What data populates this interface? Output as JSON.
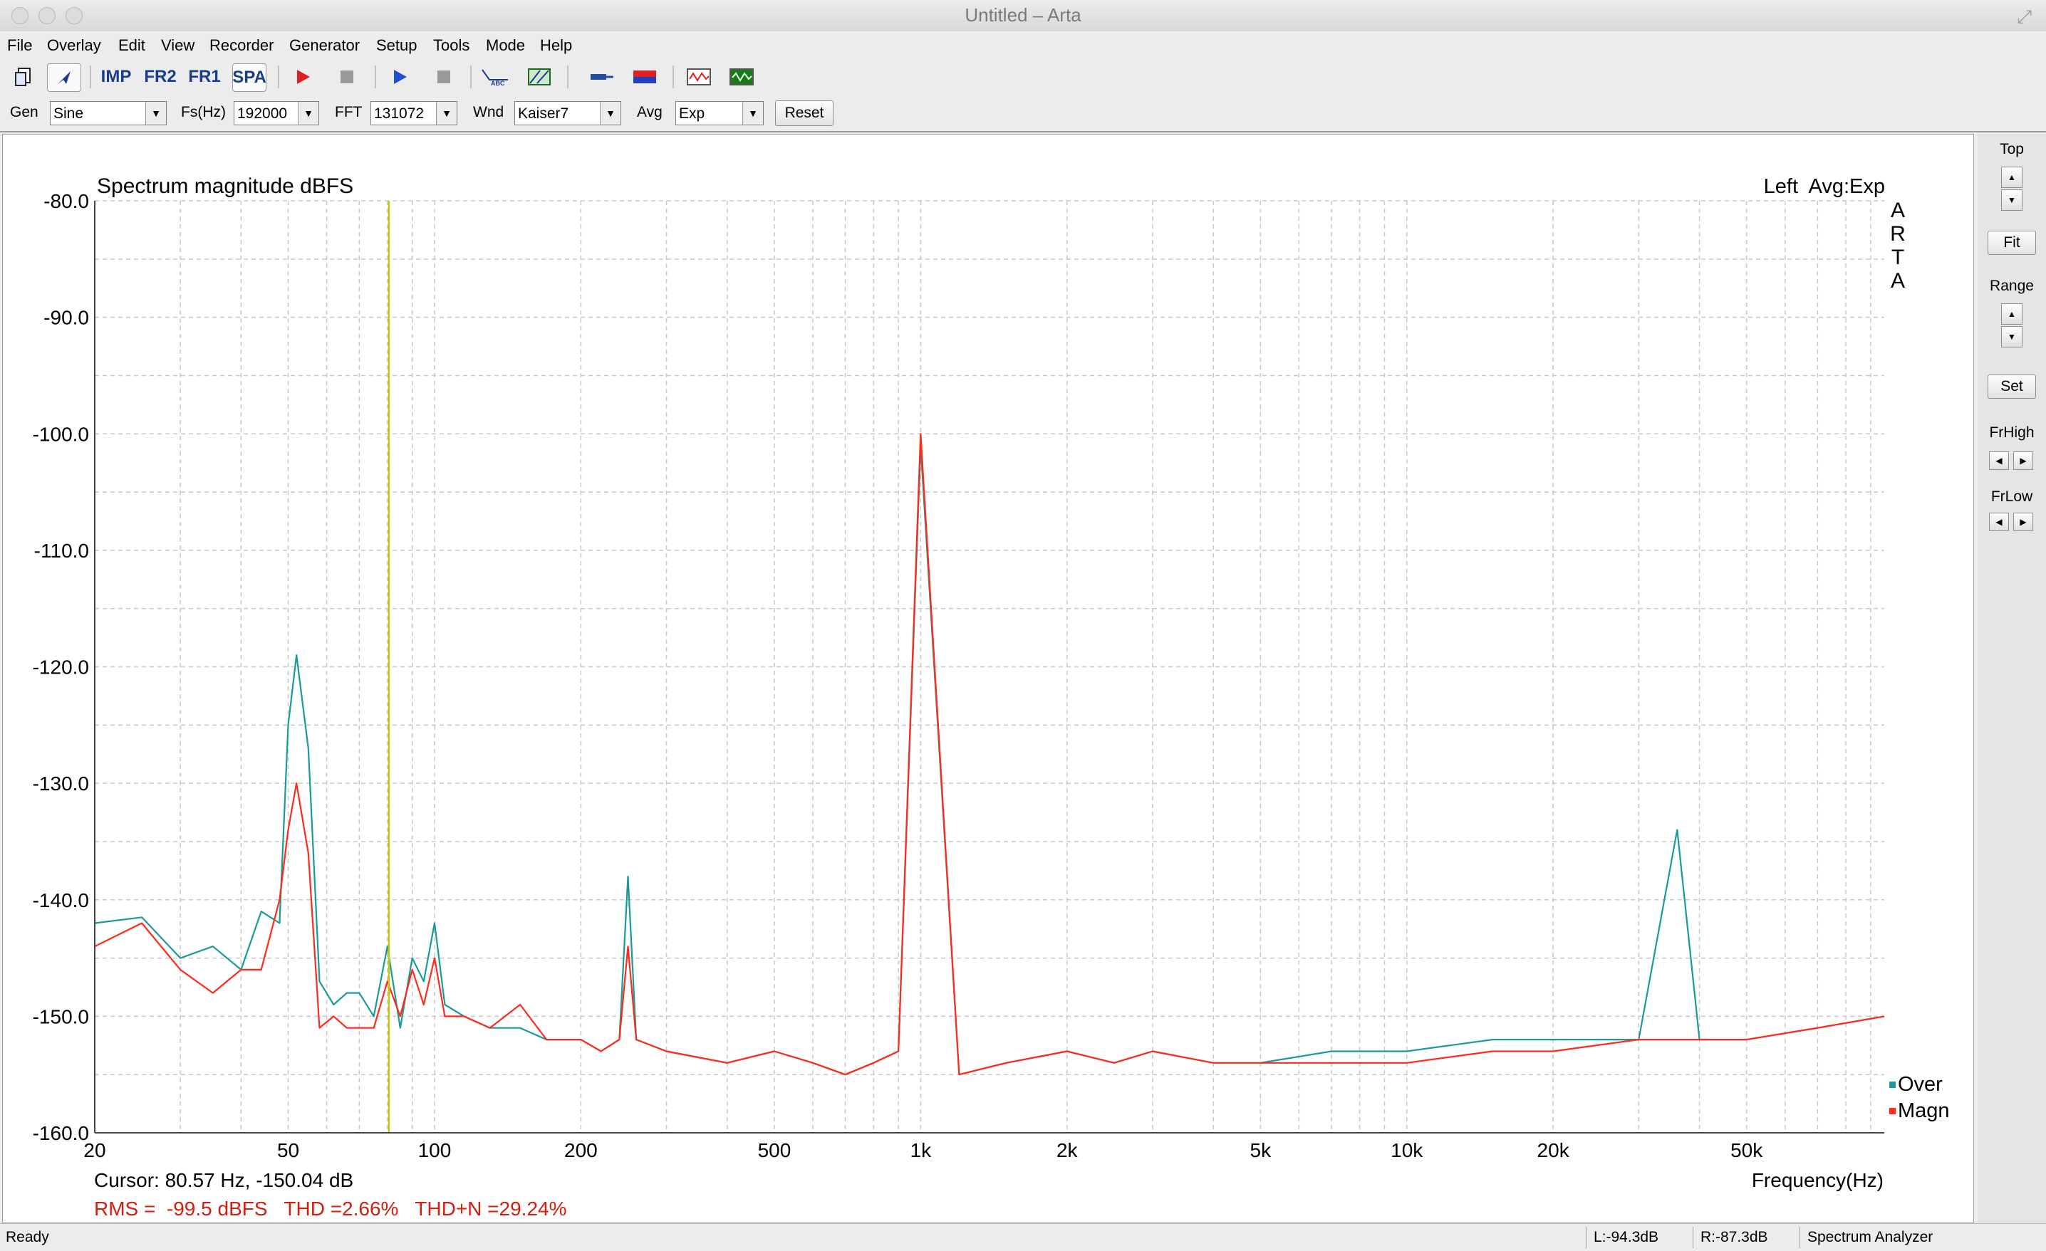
{
  "window": {
    "title": "Untitled – Arta"
  },
  "menu": [
    "File",
    "Overlay",
    "Edit",
    "View",
    "Recorder",
    "Generator",
    "Setup",
    "Tools",
    "Mode",
    "Help"
  ],
  "toolbar": {
    "imp_label": "IMP",
    "fr2_label": "FR2",
    "fr1_label": "FR1",
    "spa_label": "SPA"
  },
  "controls": {
    "gen_label": "Gen",
    "gen_value": "Sine",
    "fs_label": "Fs(Hz)",
    "fs_value": "192000",
    "fft_label": "FFT",
    "fft_value": "131072",
    "wnd_label": "Wnd",
    "wnd_value": "Kaiser7",
    "avg_label": "Avg",
    "avg_value": "Exp",
    "reset_label": "Reset"
  },
  "plot": {
    "title": "Spectrum magnitude dBFS",
    "channel_info": "Left  Avg:Exp",
    "watermark": [
      "A",
      "R",
      "T",
      "A"
    ],
    "cursor_text": "Cursor: 80.57 Hz, -150.04 dB",
    "summary_text": "RMS =  -99.5 dBFS   THD =2.66%   THD+N =29.24%",
    "x_axis_label": "Frequency(Hz)",
    "y_ticks": [
      "-80.0",
      "-90.0",
      "-100.0",
      "-110.0",
      "-120.0",
      "-130.0",
      "-140.0",
      "-150.0",
      "-160.0"
    ],
    "x_ticks": [
      "20",
      "50",
      "100",
      "200",
      "500",
      "1k",
      "2k",
      "5k",
      "10k",
      "20k",
      "50k"
    ],
    "legend": [
      {
        "name": "Over",
        "color": "#1a9a9a"
      },
      {
        "name": "Magn",
        "color": "#ff2a1a"
      }
    ],
    "colors": {
      "over": "#1a9a9a",
      "magn": "#ff2a1a",
      "cursor": "#c8c800",
      "summary": "#d02010",
      "grid": "#c8c8c8"
    }
  },
  "chart_data": {
    "type": "line",
    "title": "Spectrum magnitude dBFS",
    "xlabel": "Frequency(Hz)",
    "ylabel": "",
    "x_scale": "log",
    "xlim": [
      20,
      96000
    ],
    "ylim": [
      -160,
      -80
    ],
    "grid": true,
    "cursor_x": 80.57,
    "legend_position": "bottom-right",
    "series": [
      {
        "name": "Over",
        "x": [
          20,
          25,
          30,
          35,
          40,
          44,
          48,
          50,
          52,
          55,
          58,
          62,
          66,
          70,
          75,
          80,
          85,
          90,
          95,
          100,
          105,
          115,
          130,
          150,
          170,
          200,
          220,
          240,
          250,
          260,
          300,
          400,
          500,
          600,
          700,
          800,
          900,
          1000,
          1200,
          1500,
          2000,
          2500,
          3000,
          4000,
          5000,
          7000,
          10000,
          15000,
          20000,
          30000,
          36000,
          40000,
          50000,
          70000,
          96000
        ],
        "y": [
          -142,
          -141.5,
          -145,
          -144,
          -146,
          -141,
          -142,
          -125,
          -119,
          -127,
          -147,
          -149,
          -148,
          -148,
          -150,
          -144,
          -151,
          -145,
          -147,
          -142,
          -149,
          -150,
          -151,
          -151,
          -152,
          -152,
          -153,
          -152,
          -138,
          -152,
          -153,
          -154,
          -153,
          -154,
          -155,
          -154,
          -153,
          -101,
          -155,
          -154,
          -153,
          -154,
          -153,
          -154,
          -154,
          -153,
          -153,
          -152,
          -152,
          -152,
          -134,
          -152,
          -152,
          -151,
          -150
        ]
      },
      {
        "name": "Magn",
        "x": [
          20,
          25,
          30,
          35,
          40,
          44,
          48,
          50,
          52,
          55,
          58,
          62,
          66,
          70,
          75,
          80,
          85,
          90,
          95,
          100,
          105,
          115,
          130,
          150,
          170,
          200,
          220,
          240,
          250,
          260,
          300,
          400,
          500,
          600,
          700,
          800,
          900,
          1000,
          1200,
          1500,
          2000,
          2500,
          3000,
          4000,
          5000,
          7000,
          10000,
          15000,
          20000,
          30000,
          36000,
          40000,
          50000,
          70000,
          96000
        ],
        "y": [
          -144,
          -142,
          -146,
          -148,
          -146,
          -146,
          -140,
          -134,
          -130,
          -136,
          -151,
          -150,
          -151,
          -151,
          -151,
          -147,
          -150,
          -146,
          -149,
          -145,
          -150,
          -150,
          -151,
          -149,
          -152,
          -152,
          -153,
          -152,
          -144,
          -152,
          -153,
          -154,
          -153,
          -154,
          -155,
          -154,
          -153,
          -100,
          -155,
          -154,
          -153,
          -154,
          -153,
          -154,
          -154,
          -154,
          -154,
          -153,
          -153,
          -152,
          -152,
          -152,
          -152,
          -151,
          -150
        ]
      }
    ]
  },
  "side_panel": {
    "top_label": "Top",
    "fit_label": "Fit",
    "range_label": "Range",
    "set_label": "Set",
    "frhigh_label": "FrHigh",
    "frlow_label": "FrLow"
  },
  "status": {
    "ready": "Ready",
    "left_level": "L:-94.3dB",
    "right_level": "R:-87.3dB",
    "mode": "Spectrum Analyzer"
  }
}
